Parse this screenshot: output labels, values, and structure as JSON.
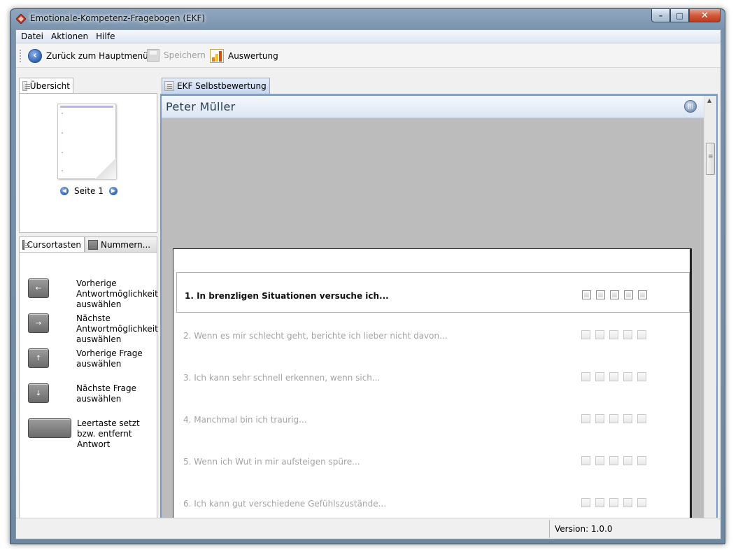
{
  "window": {
    "title": "Emotionale-Kompetenz-Fragebogen (EKF)"
  },
  "menu": {
    "items": [
      "Datei",
      "Aktionen",
      "Hilfe"
    ]
  },
  "toolbar": {
    "back_label": "Zurück zum Hauptmenü",
    "save_label": "Speichern",
    "evaluation_label": "Auswertung"
  },
  "overview": {
    "tab_label": "Übersicht",
    "page_label": "Seite 1"
  },
  "help_tabs": {
    "cursor_label": "Cursortasten",
    "numbers_label": "Nummern..."
  },
  "key_help": [
    {
      "key": "←",
      "text": "Vorherige Antwortmöglichkeit auswählen"
    },
    {
      "key": "→",
      "text": "Nächste Antwortmöglichkeit auswählen"
    },
    {
      "key": "↑",
      "text": "Vorherige Frage auswählen"
    },
    {
      "key": "↓",
      "text": "Nächste Frage auswählen"
    },
    {
      "key": "",
      "text": "Leertaste setzt bzw. entfernt Antwort"
    }
  ],
  "main": {
    "tab_label": "EKF Selbstbewertung",
    "person_name": "Peter Müller",
    "questions": [
      "1. In brenzligen Situationen versuche ich...",
      "2. Wenn es mir schlecht geht, berichte ich lieber nicht davon...",
      "3. Ich kann sehr schnell erkennen, wenn sich...",
      "4. Manchmal bin ich traurig...",
      "5. Wenn ich Wut in mir aufsteigen spüre...",
      "6. Ich kann gut verschiedene Gefühlszustände..."
    ]
  },
  "status": {
    "version": "Version: 1.0.0"
  },
  "colors": {
    "accent": "#7b9bc5",
    "tab_active": "#c5d6ee",
    "muted_text": "#a3a3a3"
  }
}
